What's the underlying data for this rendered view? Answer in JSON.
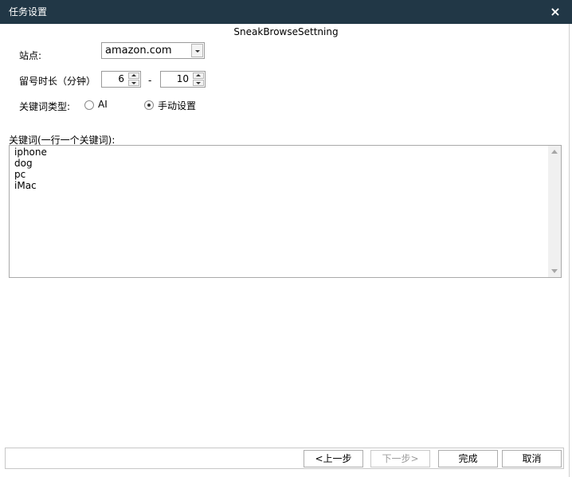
{
  "window": {
    "title": "任务设置",
    "close_glyph": "×"
  },
  "header": {
    "label": "SneakBrowseSettning"
  },
  "form": {
    "site": {
      "label": "站点:",
      "value": "amazon.com"
    },
    "stay_duration": {
      "label": "留号时长（分钟）",
      "min": "6",
      "separator": "-",
      "max": "10"
    },
    "keyword_type": {
      "label": "关键词类型:",
      "options": [
        {
          "label": "AI",
          "checked": false
        },
        {
          "label": "手动设置",
          "checked": true
        }
      ]
    },
    "keywords": {
      "label": "关键词(一行一个关键词):",
      "lines": [
        "iphone",
        "dog",
        "pc",
        "iMac"
      ]
    }
  },
  "footer": {
    "prev_label": "<上一步",
    "next_label": "下一步>",
    "finish_label": "完成",
    "cancel_label": "取消"
  },
  "colors": {
    "titlebar": "#213746"
  }
}
